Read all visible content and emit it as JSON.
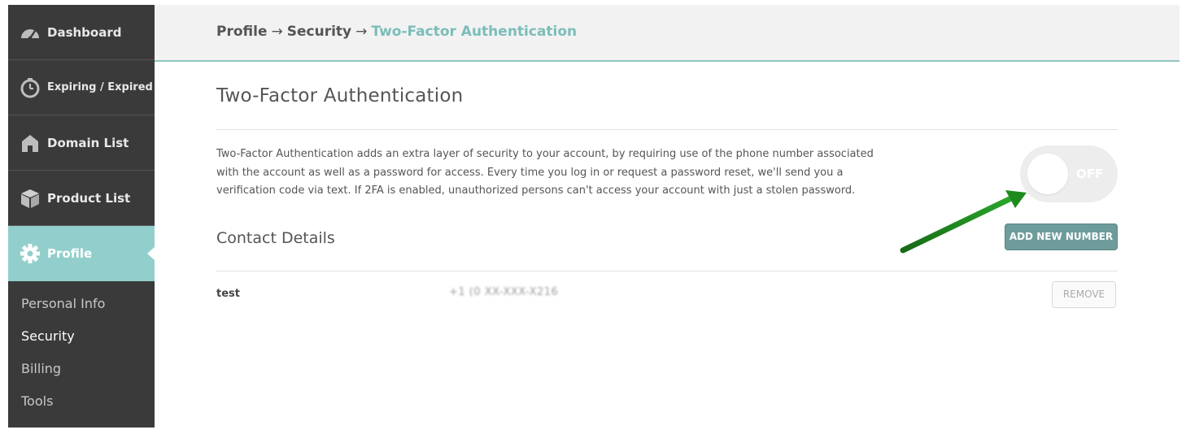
{
  "sidebar": {
    "items": [
      {
        "label": "Dashboard",
        "icon": "dashboard-gauge-icon"
      },
      {
        "label": "Expiring / Expired",
        "icon": "stopwatch-icon"
      },
      {
        "label": "Domain List",
        "icon": "house-icon"
      },
      {
        "label": "Product List",
        "icon": "box-icon"
      },
      {
        "label": "Profile",
        "icon": "gear-icon"
      }
    ],
    "subitems": [
      {
        "label": "Personal Info"
      },
      {
        "label": "Security"
      },
      {
        "label": "Billing"
      },
      {
        "label": "Tools"
      }
    ]
  },
  "breadcrumb": {
    "items": [
      "Profile",
      "Security"
    ],
    "separator": "→",
    "current": "Two-Factor Authentication"
  },
  "main": {
    "title": "Two-Factor Authentication",
    "description": "Two-Factor Authentication adds an extra layer of security to your account, by requiring use of the phone number associated with the account as well as a password for access. Every time you log in or request a password reset, we'll send you a verification code via text. If 2FA is enabled, unauthorized persons can't access your account with just a stolen password.",
    "toggle": {
      "state_label": "OFF",
      "enabled": false
    },
    "contact_section_title": "Contact Details",
    "add_button_label": "ADD NEW NUMBER",
    "contacts": [
      {
        "name": "test",
        "phone": "+1 (0 XX-XXX-X216",
        "remove_label": "REMOVE"
      }
    ]
  },
  "colors": {
    "accent": "#92cfcc",
    "breadcrumb_current": "#7bbdb9",
    "sidebar_bg": "#3a3a3a",
    "button_bg": "#6e9c9b",
    "annotation_arrow": "#1e8a1e"
  }
}
